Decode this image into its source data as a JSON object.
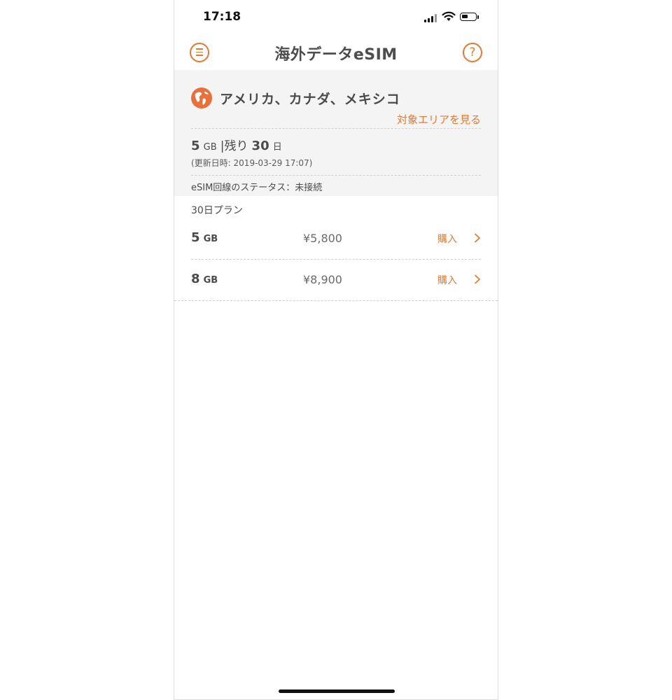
{
  "status_bar": {
    "time": "17:18"
  },
  "nav": {
    "title": "海外データeSIM",
    "menu_icon": "menu-icon",
    "help_label": "?"
  },
  "summary": {
    "region_name": "アメリカ、カナダ、メキシコ",
    "area_link": "対象エリアを見る",
    "usage": {
      "amount": "5",
      "unit": "GB",
      "separator": "|",
      "remaining_label": "残り",
      "days": "30",
      "days_unit": "日"
    },
    "updated": "(更新日時: 2019-03-29 17:07)",
    "esim_status": "eSIM回線のステータス：未接続"
  },
  "plans": {
    "title": "30日プラン",
    "items": [
      {
        "amount": "5",
        "unit": "GB",
        "price": "¥5,800",
        "action": "購入"
      },
      {
        "amount": "8",
        "unit": "GB",
        "price": "¥8,900",
        "action": "購入"
      }
    ]
  },
  "colors": {
    "accent": "#e07a35",
    "summary_bg": "#f4f4f4",
    "text": "#4a4a4a"
  }
}
